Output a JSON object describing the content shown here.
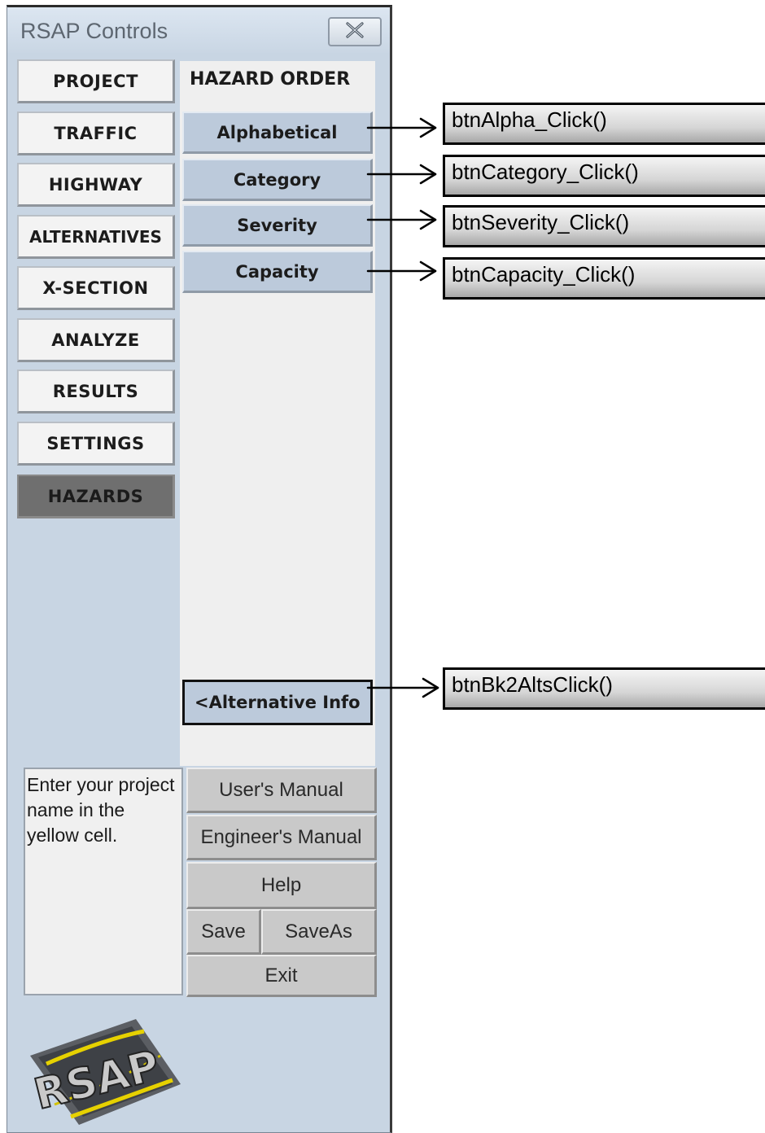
{
  "window": {
    "title": "RSAP Controls",
    "close_icon": "close-icon"
  },
  "nav": {
    "items": [
      {
        "label": "PROJECT",
        "active": false
      },
      {
        "label": "TRAFFIC",
        "active": false
      },
      {
        "label": "HIGHWAY",
        "active": false
      },
      {
        "label": "ALTERNATIVES",
        "active": false
      },
      {
        "label": "X-SECTION",
        "active": false
      },
      {
        "label": "ANALYZE",
        "active": false
      },
      {
        "label": "RESULTS",
        "active": false
      },
      {
        "label": "SETTINGS",
        "active": false
      },
      {
        "label": "HAZARDS",
        "active": true
      }
    ]
  },
  "panel": {
    "title": "HAZARD ORDER",
    "buttons": [
      "Alphabetical",
      "Category",
      "Severity",
      "Capacity"
    ],
    "back_button": "<Alternative Info"
  },
  "message": "Enter your project name in the yellow cell.",
  "utilities": {
    "users_manual": "User's Manual",
    "engineers_manual": "Engineer's Manual",
    "help": "Help",
    "save": "Save",
    "save_as": "SaveAs",
    "exit": "Exit"
  },
  "logo": {
    "text": "RSAP",
    "icon": "rsap-logo"
  },
  "annotations": [
    "btnAlpha_Click()",
    "btnCategory_Click()",
    "btnSeverity_Click()",
    "btnCapacity_Click()",
    "btnBk2AltsClick()"
  ],
  "colors": {
    "window_bg": "#c8d5e3",
    "order_button_bg": "#bccadb",
    "active_nav_bg": "#6f6f6f"
  }
}
